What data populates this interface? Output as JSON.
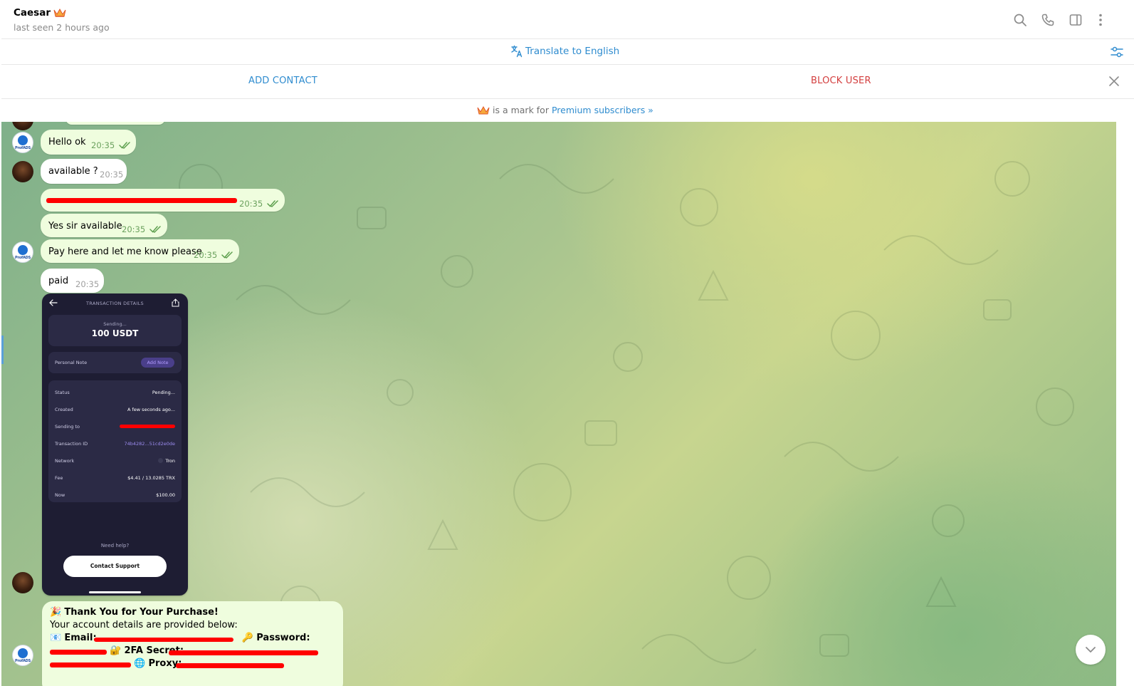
{
  "header": {
    "name": "Caesar",
    "status": "last seen 2 hours ago",
    "icons": [
      "search-icon",
      "phone-icon",
      "sidebar-icon",
      "more-icon"
    ]
  },
  "translate_bar": {
    "label": "Translate to English"
  },
  "action_bar": {
    "add_contact": "ADD CONTACT",
    "block_user": "BLOCK USER"
  },
  "premium_bar": {
    "text": "is a mark for",
    "link": "Premium subscribers »"
  },
  "messages": [
    {
      "text": "Hello ok",
      "time": "20:35",
      "outgoing": true
    },
    {
      "text": "available ?",
      "time": "20:35",
      "outgoing": false
    },
    {
      "text": "",
      "time": "20:35",
      "outgoing": true
    },
    {
      "text": "Yes sir available",
      "time": "20:35",
      "outgoing": true
    },
    {
      "text": "Pay here and let me know please",
      "time": "20:35",
      "outgoing": true
    },
    {
      "text": "paid",
      "time": "20:35",
      "outgoing": false
    }
  ],
  "screenshot": {
    "title": "TRANSACTION DETAILS",
    "sending": "Sending...",
    "amount": "100 USDT",
    "note_label": "Personal Note",
    "add_note": "Add Note",
    "rows": [
      {
        "key": "Status",
        "value": "Pending..."
      },
      {
        "key": "Created",
        "value": "A few seconds ago..."
      },
      {
        "key": "Sending to",
        "value": ""
      },
      {
        "key": "Transaction ID",
        "value": "74b4282...51cd2e0de"
      },
      {
        "key": "Network",
        "value": "Tron"
      },
      {
        "key": "Fee",
        "value": "$4.41 / 13.0285 TRX"
      },
      {
        "key": "Now",
        "value": "$100.00"
      }
    ],
    "help": "Need help?",
    "support": "Contact Support"
  },
  "final_message": {
    "line1": "Thank You for Your Purchase!",
    "line2": "Your account details are provided below:",
    "email_label": "Email:",
    "password_label": "Password:",
    "twofa_label": "2FA Secret:",
    "proxy_label": "Proxy:"
  },
  "colors": {
    "accent": "#2f8ccf",
    "danger": "#d33e3e",
    "outgoing_bubble": "#effdde",
    "time_outgoing": "#6ba15e"
  }
}
